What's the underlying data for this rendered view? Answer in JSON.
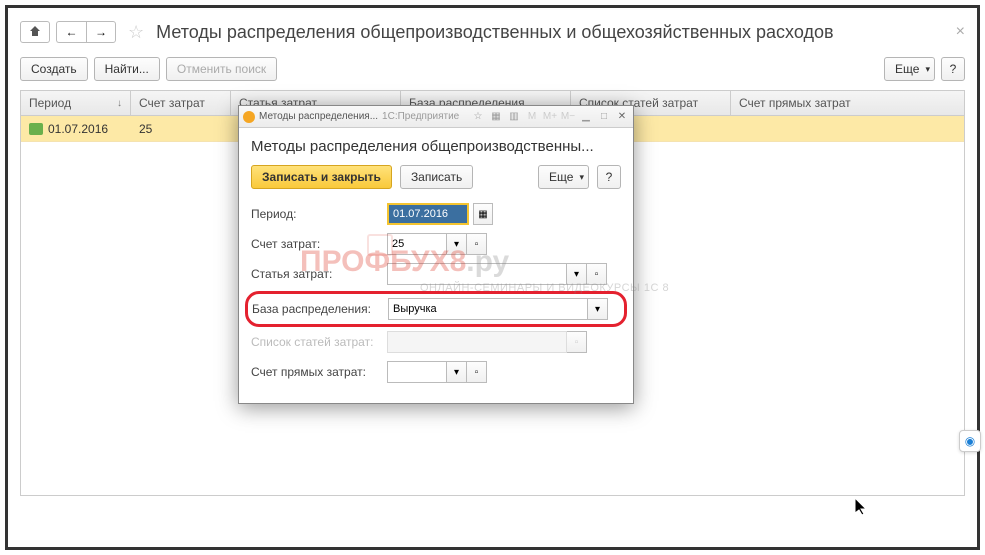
{
  "page": {
    "title": "Методы распределения общепроизводственных и общехозяйственных расходов"
  },
  "toolbar": {
    "create": "Создать",
    "find": "Найти...",
    "cancel_search": "Отменить поиск",
    "more": "Еще",
    "help": "?"
  },
  "columns": {
    "period": "Период",
    "account": "Счет затрат",
    "cost_item": "Статья затрат",
    "base": "База распределения",
    "item_list": "Список статей затрат",
    "direct_account": "Счет прямых затрат"
  },
  "rows": [
    {
      "period": "01.07.2016",
      "account": "25"
    }
  ],
  "dialog": {
    "tab_title": "Методы распределения...",
    "platform": "1С:Предприятие",
    "heading": "Методы распределения общепроизводственны...",
    "save_close": "Записать и закрыть",
    "save": "Записать",
    "more": "Еще",
    "help": "?",
    "labels": {
      "period": "Период:",
      "account": "Счет затрат:",
      "cost_item": "Статья затрат:",
      "base": "База распределения:",
      "item_list": "Список статей затрат:",
      "direct_account": "Счет прямых затрат:"
    },
    "values": {
      "period": "01.07.2016",
      "account": "25",
      "cost_item": "",
      "base": "Выручка",
      "item_list": "",
      "direct_account": ""
    }
  },
  "watermark": {
    "brand1": "ПРОФБУХ8",
    "brand2": ".ру",
    "subtitle": "ОНЛАЙН-СЕМИНАРЫ И ВИДЕОКУРСЫ 1С 8"
  }
}
